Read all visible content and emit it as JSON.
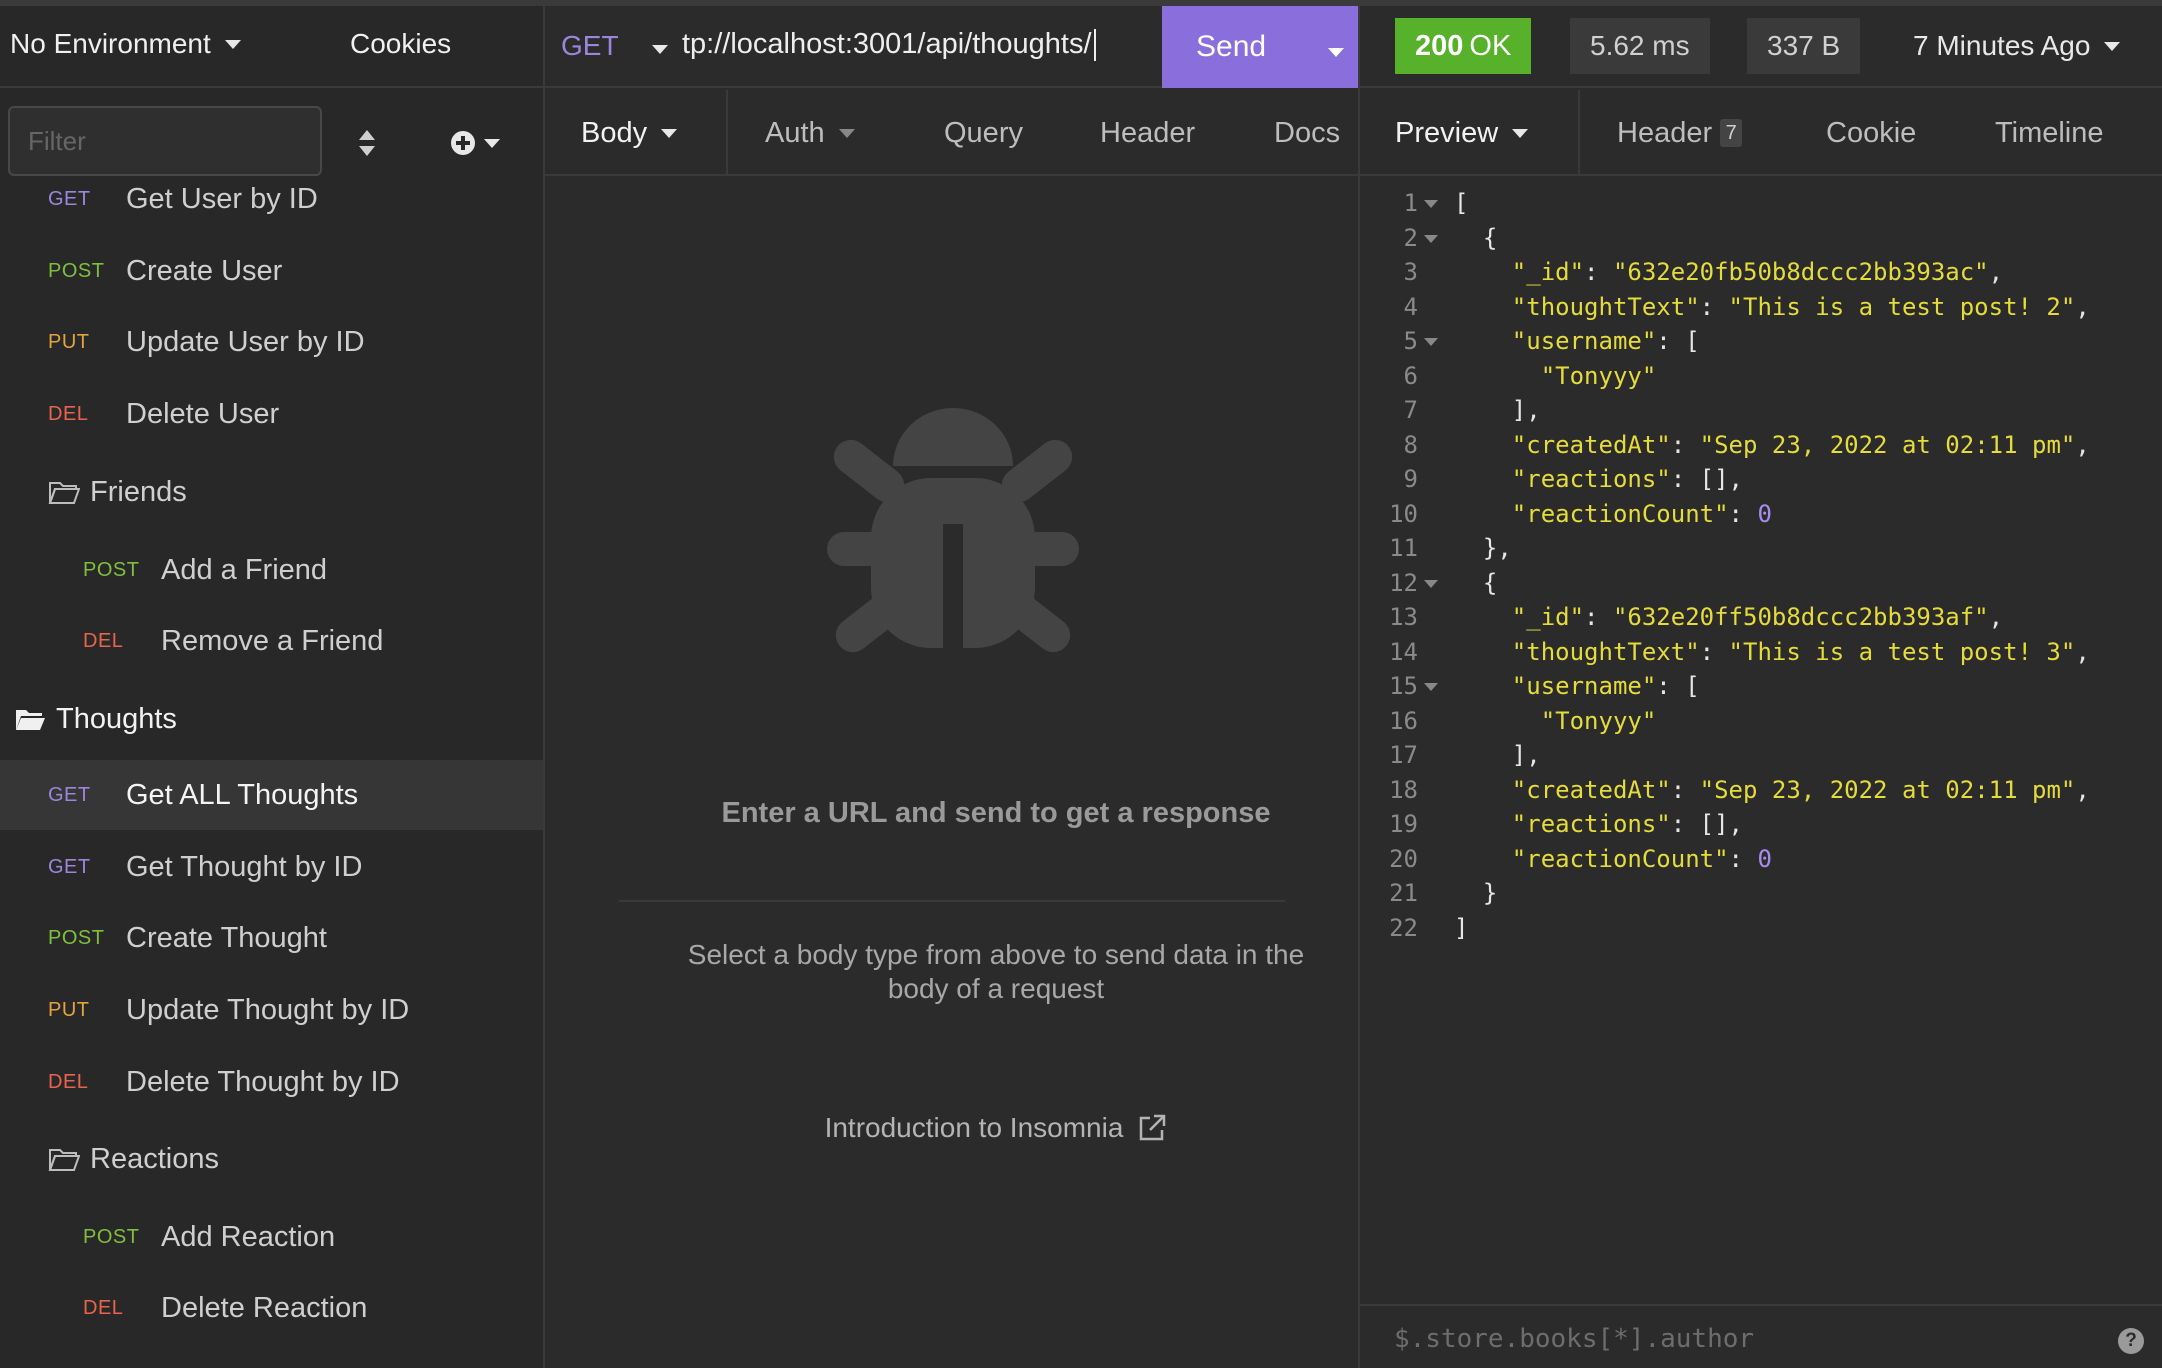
{
  "sidebar": {
    "environment": "No Environment",
    "cookies_label": "Cookies",
    "filter_placeholder": "Filter",
    "partial_item": {
      "method": "GET",
      "label": "Get User by ID"
    },
    "items": [
      {
        "method": "POST",
        "label": "Create User"
      },
      {
        "method": "PUT",
        "label": "Update User by ID"
      },
      {
        "method": "DEL",
        "label": "Delete User"
      }
    ],
    "friends_folder": "Friends",
    "friends_items": [
      {
        "method": "POST",
        "label": "Add a Friend"
      },
      {
        "method": "DEL",
        "label": "Remove a Friend"
      }
    ],
    "thoughts_folder": "Thoughts",
    "thoughts_items": [
      {
        "method": "GET",
        "label": "Get ALL Thoughts"
      },
      {
        "method": "GET",
        "label": "Get Thought by ID"
      },
      {
        "method": "POST",
        "label": "Create Thought"
      },
      {
        "method": "PUT",
        "label": "Update Thought by ID"
      },
      {
        "method": "DEL",
        "label": "Delete Thought by ID"
      }
    ],
    "reactions_folder": "Reactions",
    "reactions_items": [
      {
        "method": "POST",
        "label": "Add Reaction"
      },
      {
        "method": "DEL",
        "label": "Delete Reaction"
      }
    ]
  },
  "request": {
    "method": "GET",
    "url": "tp://localhost:3001/api/thoughts/",
    "send_label": "Send",
    "tabs": [
      "Body",
      "Auth",
      "Query",
      "Header",
      "Docs"
    ],
    "empty_title": "Enter a URL and send to get a response",
    "empty_sub": "Select a body type from above to send data in the body of a request",
    "intro_link": "Introduction to Insomnia"
  },
  "response": {
    "status_code": "200",
    "status_text": "OK",
    "time": "5.62 ms",
    "size": "337 B",
    "age": "7 Minutes Ago",
    "tabs": [
      "Preview",
      "Header",
      "Cookie",
      "Timeline"
    ],
    "header_count": "7",
    "jsonpath_placeholder": "$.store.books[*].author",
    "help_icon": "?",
    "code": {
      "id1": "\"632e20fb50b8dccc2bb393ac\"",
      "id2": "\"632e20ff50b8dccc2bb393af\"",
      "text1": "\"This is a test post! 2\"",
      "text2": "\"This is a test post! 3\"",
      "username": "\"Tonyyy\"",
      "created": "\"Sep 23, 2022 at 02:11 pm\"",
      "count": "0",
      "k_id": "\"_id\"",
      "k_text": "\"thoughtText\"",
      "k_user": "\"username\"",
      "k_created": "\"createdAt\"",
      "k_reactions": "\"reactions\"",
      "k_count": "\"reactionCount\""
    }
  },
  "colors": {
    "get": "#9c86dd",
    "post": "#7ec03d",
    "put": "#e5a33b",
    "del": "#e9634f",
    "send": "#8a6fdc",
    "status_ok": "#58b12b"
  }
}
